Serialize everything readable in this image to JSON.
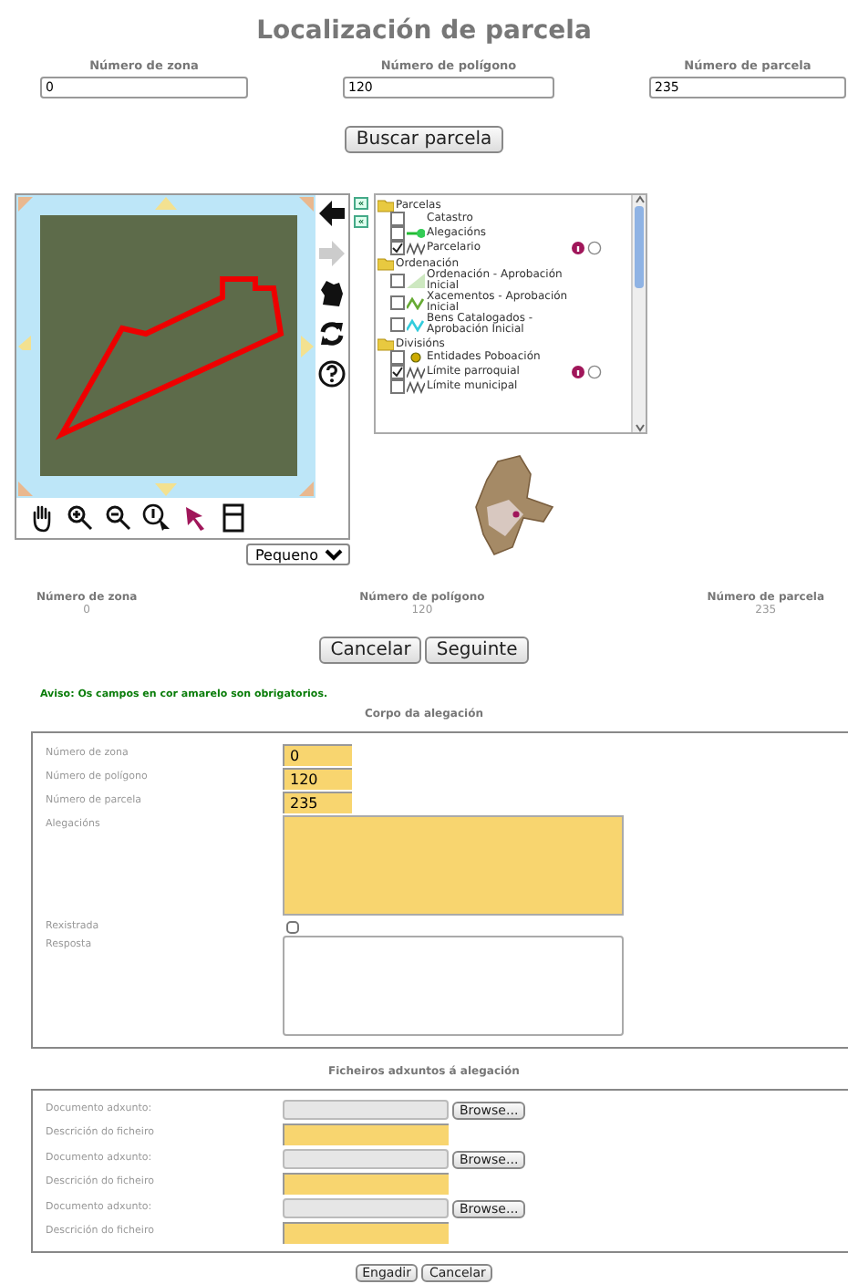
{
  "title": "Localización de parcela",
  "search_fields": [
    {
      "label": "Número de zona",
      "value": "0"
    },
    {
      "label": "Número de polígono",
      "value": "120"
    },
    {
      "label": "Número de parcela",
      "value": "235"
    }
  ],
  "search_button": "Buscar parcela",
  "map": {
    "side_tools": [
      {
        "kind": "back",
        "disabled": false
      },
      {
        "kind": "forward",
        "disabled": true
      },
      {
        "kind": "extent",
        "disabled": false
      },
      {
        "kind": "refresh",
        "disabled": false
      },
      {
        "kind": "help",
        "disabled": false
      }
    ],
    "bottom_tools": [
      {
        "kind": "pan",
        "selected": false
      },
      {
        "kind": "zoom-in",
        "selected": false
      },
      {
        "kind": "zoom-out",
        "selected": false
      },
      {
        "kind": "info",
        "selected": false
      },
      {
        "kind": "select",
        "selected": true
      },
      {
        "kind": "layout",
        "selected": false
      }
    ],
    "size_select": "Pequeno"
  },
  "collapse_buttons": [
    "«",
    "«"
  ],
  "layers": [
    {
      "label": "Parcelas",
      "children": [
        {
          "label": "Catastro",
          "kind": "none",
          "checked": false
        },
        {
          "label": "Alegacións",
          "kind": "point-line",
          "checked": false
        },
        {
          "label": "Parcelario",
          "kind": "line",
          "checked": true,
          "radio_on": false
        }
      ]
    },
    {
      "label": "Ordenación",
      "children": [
        {
          "label": "Ordenación - Aprobación Inicial",
          "kind": "fill",
          "checked": false
        },
        {
          "label": "Xacementos - Aprobación Inicial",
          "kind": "green-line",
          "checked": false
        },
        {
          "label": "Bens Catalogados - Aprobación Inicial",
          "kind": "cyan-line",
          "checked": false
        }
      ]
    },
    {
      "label": "Divisións",
      "children": [
        {
          "label": "Entidades Poboación",
          "kind": "point",
          "checked": false
        },
        {
          "label": "Límite parroquial",
          "kind": "line",
          "checked": true,
          "radio_on": false
        },
        {
          "label": "Límite municipal",
          "kind": "line",
          "checked": false
        }
      ]
    }
  ],
  "summary": [
    {
      "label": "Número de zona",
      "value": "0"
    },
    {
      "label": "Número de polígono",
      "value": "120"
    },
    {
      "label": "Número de parcela",
      "value": "235"
    }
  ],
  "step_buttons": [
    "Cancelar",
    "Seguinte"
  ],
  "notice": "Aviso: Os campos en cor amarelo son obrigatorios.",
  "body_section": {
    "title": "Corpo da alegación",
    "rows": [
      {
        "label": "Número de zona",
        "kind": "input",
        "value": "0",
        "required": true
      },
      {
        "label": "Número de polígono",
        "kind": "input",
        "value": "120",
        "required": true
      },
      {
        "label": "Número de parcela",
        "kind": "input",
        "value": "235",
        "required": true
      },
      {
        "label": "Alegacións",
        "kind": "textarea",
        "required": true
      },
      {
        "label": "Rexistrada",
        "kind": "checkbox",
        "checked": false
      },
      {
        "label": "Resposta",
        "kind": "textarea",
        "required": false
      }
    ]
  },
  "attachments_section": {
    "title": "Ficheiros adxuntos á alegación",
    "rows": [
      {
        "label": "Documento adxunto:",
        "kind": "file",
        "button": "Browse..."
      },
      {
        "label": "Descrición do ficheiro",
        "kind": "wide-input",
        "required": true
      },
      {
        "label": "Documento adxunto:",
        "kind": "file",
        "button": "Browse..."
      },
      {
        "label": "Descrición do ficheiro",
        "kind": "wide-input",
        "required": true
      },
      {
        "label": "Documento adxunto:",
        "kind": "file",
        "button": "Browse..."
      },
      {
        "label": "Descrición do ficheiro",
        "kind": "wide-input",
        "required": true
      }
    ]
  },
  "final_buttons": [
    "Engadir",
    "Cancelar"
  ]
}
